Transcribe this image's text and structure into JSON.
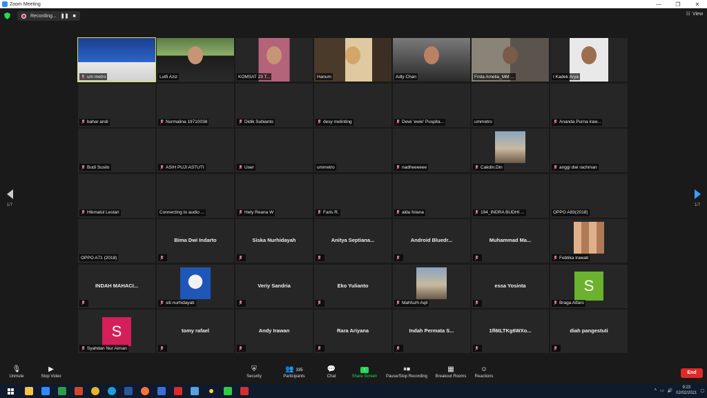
{
  "window": {
    "title": "Zoom Meeting",
    "minimize": "—",
    "restore": "❐",
    "close": "✕"
  },
  "topbar": {
    "recording_label": "Recording...",
    "pause_icon": "pause-icon",
    "stop_icon": "stop-icon",
    "view_label": "View"
  },
  "pager": {
    "left_page": "1/7",
    "right_page": "1/7"
  },
  "participants": [
    {
      "name": "um metro",
      "mode": "video",
      "muted": true,
      "active": true
    },
    {
      "name": "Lutfi Aziz",
      "mode": "video",
      "muted": false
    },
    {
      "name": "KOMSAT 23 T...",
      "mode": "video",
      "muted": false
    },
    {
      "name": "Hanum",
      "mode": "video",
      "muted": false
    },
    {
      "name": "Adly Chan",
      "mode": "video",
      "muted": false
    },
    {
      "name": "Frida Amelia_MM ...",
      "mode": "video",
      "muted": false
    },
    {
      "name": "I Kadek Arya",
      "mode": "video",
      "muted": false
    },
    {
      "name": "bahar andi",
      "mode": "label",
      "muted": true
    },
    {
      "name": "Nurmalina 19710038",
      "mode": "label",
      "muted": true
    },
    {
      "name": "Didik Subianto",
      "mode": "label",
      "muted": true
    },
    {
      "name": "desy melinting",
      "mode": "label",
      "muted": true
    },
    {
      "name": "Dewi 'ewie' Puspita...",
      "mode": "label",
      "muted": true
    },
    {
      "name": "ummetro",
      "mode": "label",
      "muted": false
    },
    {
      "name": "Ananda Purna iraw...",
      "mode": "label",
      "muted": true
    },
    {
      "name": "Budi Susilo",
      "mode": "label",
      "muted": true
    },
    {
      "name": "ASIH PUJI ASTUTI",
      "mode": "label",
      "muted": true
    },
    {
      "name": "User",
      "mode": "label",
      "muted": true
    },
    {
      "name": "ummetro",
      "mode": "label",
      "muted": false
    },
    {
      "name": "nadheeeeee",
      "mode": "label",
      "muted": true
    },
    {
      "name": "Cakdin.Din",
      "mode": "photo",
      "muted": true
    },
    {
      "name": "anggi dwi rachman",
      "mode": "label",
      "muted": true
    },
    {
      "name": "Hikmatul Lestari",
      "mode": "label",
      "muted": true
    },
    {
      "name": "Connecting to audio ...",
      "mode": "label",
      "muted": false
    },
    {
      "name": "Hety Reana W",
      "mode": "label",
      "muted": true
    },
    {
      "name": "Faris R.",
      "mode": "label",
      "muted": true
    },
    {
      "name": "alda folana",
      "mode": "label",
      "muted": true
    },
    {
      "name": "194_INDRA BUDHI ...",
      "mode": "label",
      "muted": true
    },
    {
      "name": "OPPO A83(2018)",
      "mode": "label",
      "muted": false
    },
    {
      "name": "OPPO A71 (2018)",
      "mode": "label",
      "muted": false
    },
    {
      "name": "Bima Dwi Indarto",
      "mode": "center",
      "muted": true
    },
    {
      "name": "Siska Nurhidayah",
      "mode": "center",
      "muted": true
    },
    {
      "name": "Anitya  Septiana...",
      "mode": "center",
      "muted": true
    },
    {
      "name": "Android  Bluedr...",
      "mode": "center",
      "muted": true
    },
    {
      "name": "Muhammad  Ma...",
      "mode": "center",
      "muted": true
    },
    {
      "name": "Febtika Irawati",
      "mode": "photo",
      "muted": true
    },
    {
      "name": "INDAH  MAHACI...",
      "mode": "center",
      "muted": true
    },
    {
      "name": "siti nurhidayati",
      "mode": "photo",
      "muted": true
    },
    {
      "name": "Veriy Sandria",
      "mode": "center",
      "muted": true
    },
    {
      "name": "Eko Yulianto",
      "mode": "center",
      "muted": true
    },
    {
      "name": "Mahfuzh Aqil",
      "mode": "photo",
      "muted": true
    },
    {
      "name": "essa Yosinta",
      "mode": "center",
      "muted": true
    },
    {
      "name": "Braga Alfaro",
      "mode": "avatar",
      "initial": "S",
      "color": "#6bb32e",
      "muted": true
    },
    {
      "name": "Syahdan Nur Aiman",
      "mode": "avatar",
      "initial": "S",
      "color": "#d41f5a",
      "muted": true
    },
    {
      "name": "tomy rafael",
      "mode": "center",
      "muted": true
    },
    {
      "name": "Andy Irawan",
      "mode": "center",
      "muted": true
    },
    {
      "name": "Rara Ariyana",
      "mode": "center",
      "muted": true
    },
    {
      "name": "Indah  Permata  S...",
      "mode": "center",
      "muted": true
    },
    {
      "name": "1fl6tLTKg6WXo...",
      "mode": "center",
      "muted": true
    },
    {
      "name": "diah pangestuti",
      "mode": "center",
      "muted": true
    }
  ],
  "toolbar": {
    "unmute": "Unmute",
    "stop_video": "Stop Video",
    "security": "Security",
    "participants": "Participants",
    "participants_count": "335",
    "chat": "Chat",
    "share_screen": "Share Screen",
    "pause_recording": "Pause/Stop Recording",
    "breakout_rooms": "Breakout Rooms",
    "reactions": "Reactions",
    "end": "End"
  },
  "taskbar": {
    "time": "9:23",
    "date": "02/02/2021"
  },
  "colors": {
    "accent": "#2d8cff",
    "share": "#23d959",
    "end": "#e02828",
    "active_border": "#d6e84a"
  }
}
